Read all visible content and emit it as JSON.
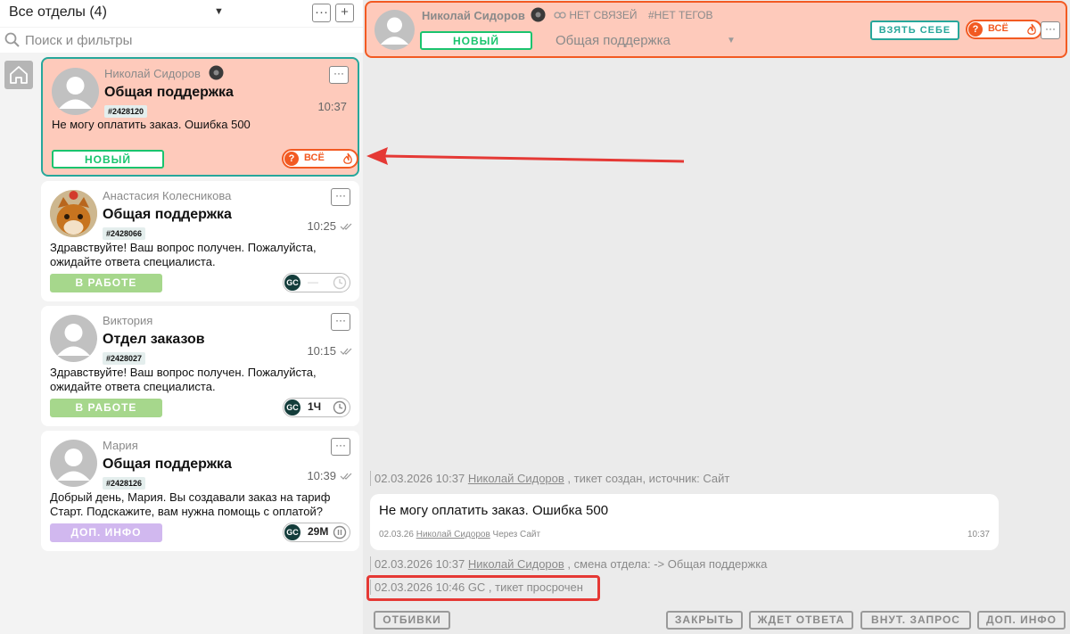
{
  "header": {
    "dept_title": "Все отделы (4)",
    "menu_label": "···",
    "add_label": "+"
  },
  "search": {
    "placeholder": "Поиск и фильтры"
  },
  "tickets": [
    {
      "name": "Николай Сидоров",
      "dept": "Общая поддержка",
      "tag": "#2428120",
      "time": "10:37",
      "message": "Не могу оплатить заказ. Ошибка 500",
      "status": "НОВЫЙ",
      "priority_label": "ВСЁ",
      "priority_mark": "?"
    },
    {
      "name": "Анастасия Колесникова",
      "dept": "Общая поддержка",
      "tag": "#2428066",
      "time": "10:25",
      "message": "Здравствуйте! Ваш вопрос получен. Пожалуйста, ожидайте ответа специалиста.",
      "status": "В РАБОТЕ",
      "timer_badge": "GC",
      "timer_value": "—"
    },
    {
      "name": "Виктория",
      "dept": "Отдел заказов",
      "tag": "#2428027",
      "time": "10:15",
      "message": "Здравствуйте! Ваш вопрос получен. Пожалуйста, ожидайте ответа специалиста.",
      "status": "В РАБОТЕ",
      "timer_badge": "GC",
      "timer_value": "1Ч"
    },
    {
      "name": "Мария",
      "dept": "Общая поддержка",
      "tag": "#2428126",
      "time": "10:39",
      "message": "Добрый день, Мария. Вы создавали заказ на тариф Старт. Подскажите, вам нужна помощь с оплатой?",
      "status": "ДОП. ИНФО",
      "timer_badge": "GC",
      "timer_value": "29М"
    }
  ],
  "topbar": {
    "name": "Николай Сидоров",
    "links": "НЕТ СВЯЗЕЙ",
    "tags": "#НЕТ ТЕГОВ",
    "status": "НОВЫЙ",
    "dept": "Общая поддержка",
    "take_label": "ВЗЯТЬ СЕБЕ",
    "priority_label": "ВСЁ",
    "priority_mark": "?",
    "menu_label": "···"
  },
  "events": {
    "e1": {
      "time": "02.03.2026 10:37",
      "user": "Николай Сидоров",
      "text": ", тикет создан, источник: Сайт"
    },
    "e2": {
      "time": "02.03.2026 10:37",
      "user": "Николай Сидоров",
      "text": ", смена отдела: -> Общая поддержка"
    },
    "e3": {
      "text": "02.03.2026 10:46 GC , тикет просрочен"
    }
  },
  "message": {
    "text": "Не могу оплатить заказ. Ошибка 500",
    "date": "02.03.26",
    "user": "Николай Сидоров",
    "source": "Через Сайт",
    "time": "10:37"
  },
  "actions": {
    "templates": "ОТБИВКИ",
    "close": "ЗАКРЫТЬ",
    "waiting": "ЖДЕТ ОТВЕТА",
    "internal": "ВНУТ. ЗАПРОС",
    "extra": "ДОП. ИНФО"
  },
  "colors": {
    "accent_teal": "#27a79b",
    "accent_orange": "#f25a22",
    "status_new": "#19c46e",
    "status_work": "#a6d78c",
    "status_info": "#d1b8ef",
    "active_card_bg": "#fecabb",
    "highlight_red": "#e53935"
  }
}
